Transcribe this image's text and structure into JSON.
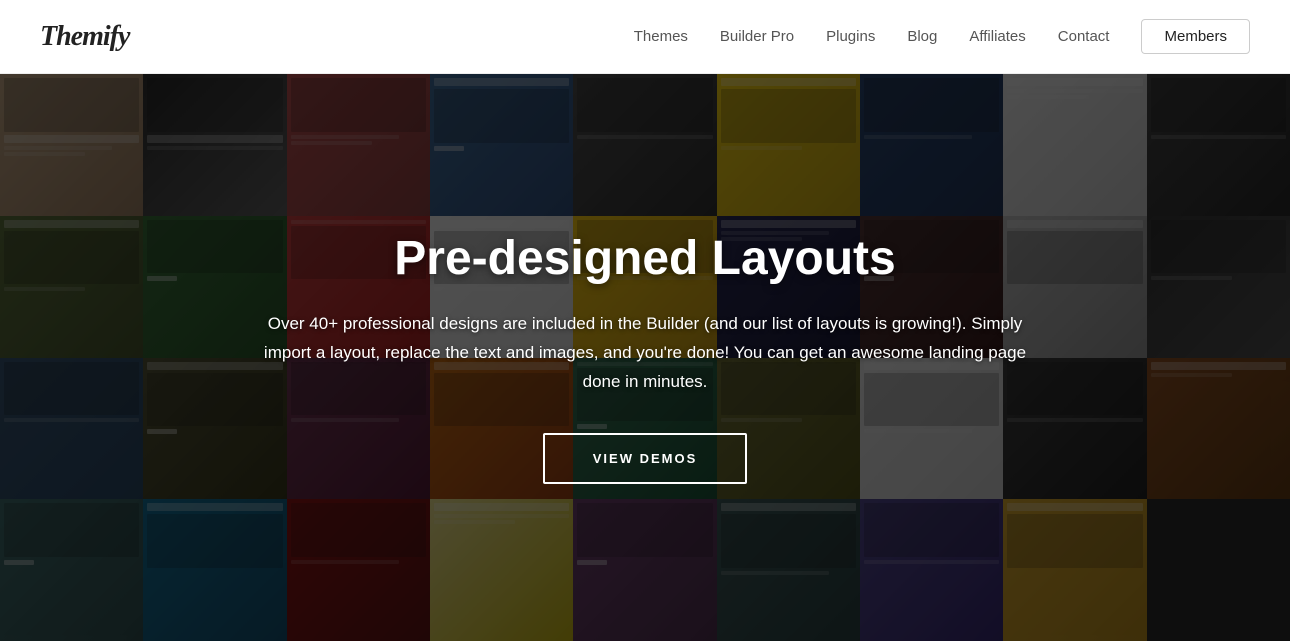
{
  "header": {
    "logo": "Themify",
    "nav": {
      "items": [
        {
          "label": "Themes",
          "id": "themes"
        },
        {
          "label": "Builder Pro",
          "id": "builder-pro"
        },
        {
          "label": "Plugins",
          "id": "plugins"
        },
        {
          "label": "Blog",
          "id": "blog"
        },
        {
          "label": "Affiliates",
          "id": "affiliates"
        },
        {
          "label": "Contact",
          "id": "contact"
        }
      ],
      "cta": "Members"
    }
  },
  "hero": {
    "title": "Pre-designed Layouts",
    "description": "Over 40+ professional designs are included in the Builder (and our list of layouts is growing!). Simply import a layout, replace the text and images, and you're done! You can get an awesome landing page done in minutes.",
    "cta_label": "VIEW DEMOS"
  }
}
